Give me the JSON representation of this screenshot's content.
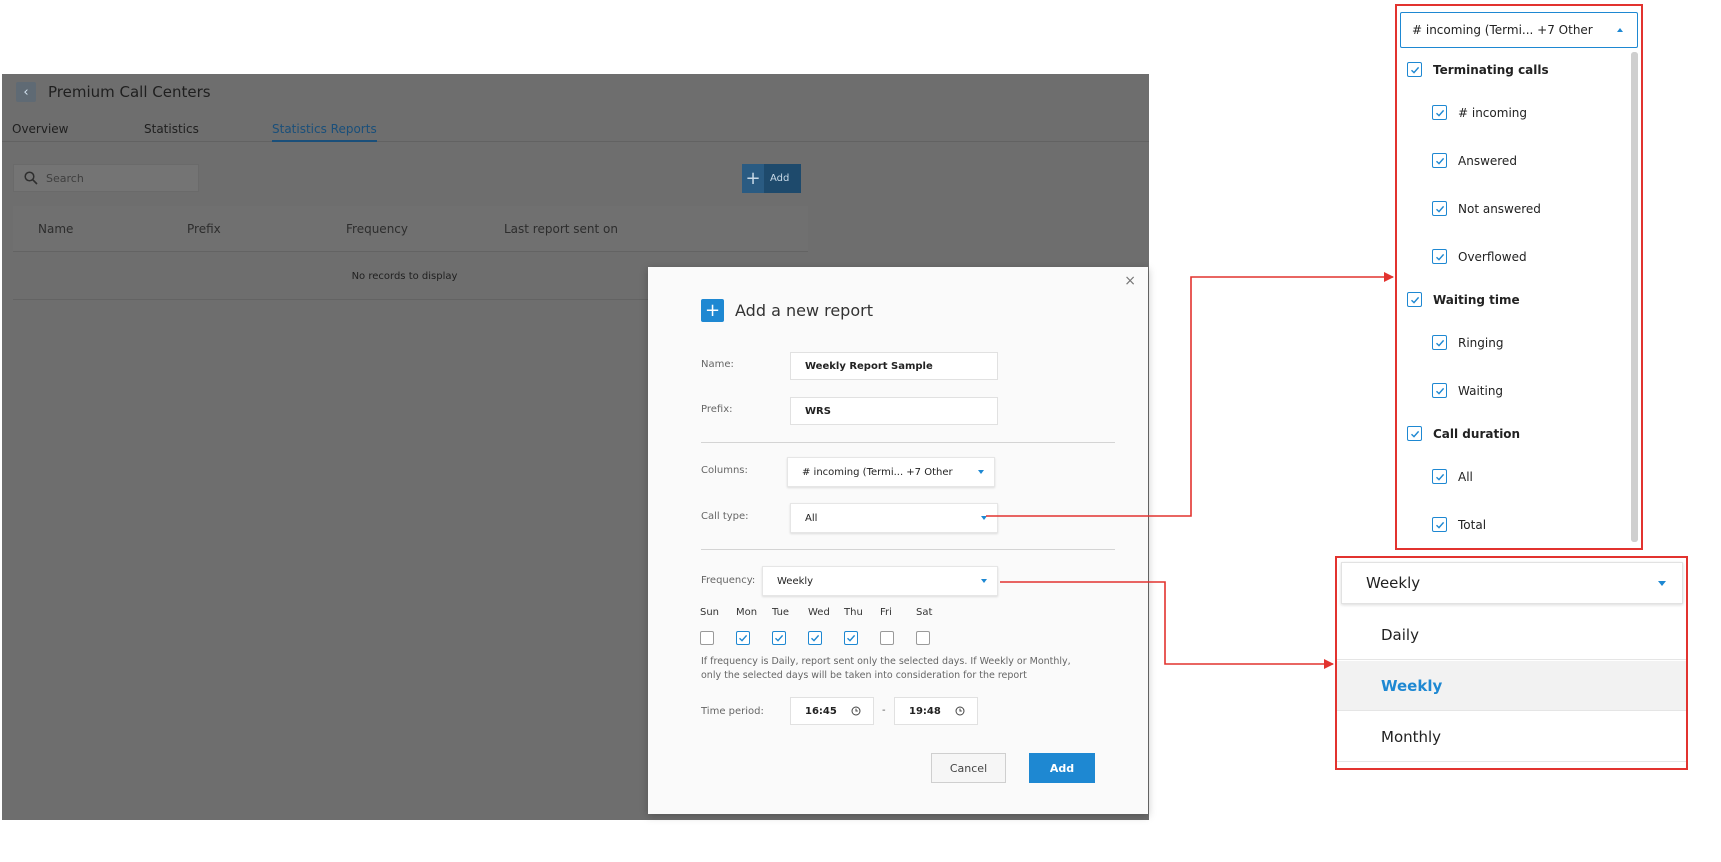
{
  "app": {
    "back_icon": "chevron-left-icon",
    "title": "Premium Call Centers",
    "tabs": [
      "Overview",
      "Statistics",
      "Statistics Reports"
    ],
    "active_tab": "Statistics Reports",
    "search_placeholder": "Search",
    "add_button_label": "Add",
    "table_columns": [
      "Name",
      "Prefix",
      "Frequency",
      "Last report sent on"
    ],
    "empty_message": "No records to display"
  },
  "modal": {
    "title": "Add a new report",
    "close_label": "×",
    "name_label": "Name:",
    "name_value": "Weekly Report Sample",
    "prefix_label": "Prefix:",
    "prefix_value": "WRS",
    "columns_label": "Columns:",
    "columns_value": "# incoming (Termi... +7 Other",
    "call_type_label": "Call type:",
    "call_type_value": "All",
    "frequency_label": "Frequency:",
    "frequency_value": "Weekly",
    "days": [
      {
        "label": "Sun",
        "checked": false
      },
      {
        "label": "Mon",
        "checked": true
      },
      {
        "label": "Tue",
        "checked": true
      },
      {
        "label": "Wed",
        "checked": true
      },
      {
        "label": "Thu",
        "checked": true
      },
      {
        "label": "Fri",
        "checked": false
      },
      {
        "label": "Sat",
        "checked": false
      }
    ],
    "note_line1": "If frequency is Daily, report sent only the selected days. If Weekly or Monthly,",
    "note_line2": "only the selected days will be taken into consideration for the report",
    "time_period_label": "Time period:",
    "time_from": "16:45",
    "time_separator": "-",
    "time_to": "19:48",
    "cancel_label": "Cancel",
    "add_label": "Add"
  },
  "columns_dropdown": {
    "selected_text": "# incoming (Termi... +7 Other",
    "items": [
      {
        "label": "Terminating calls",
        "group": true
      },
      {
        "label": "# incoming",
        "group": false
      },
      {
        "label": "Answered",
        "group": false
      },
      {
        "label": "Not answered",
        "group": false
      },
      {
        "label": "Overflowed",
        "group": false
      },
      {
        "label": "Waiting time",
        "group": true
      },
      {
        "label": "Ringing",
        "group": false
      },
      {
        "label": "Waiting",
        "group": false
      },
      {
        "label": "Call duration",
        "group": true
      },
      {
        "label": "All",
        "group": false
      },
      {
        "label": "Total",
        "group": false
      }
    ]
  },
  "frequency_dropdown": {
    "selected_text": "Weekly",
    "options": [
      "Daily",
      "Weekly",
      "Monthly"
    ],
    "selected_option": "Weekly"
  },
  "colors": {
    "accent": "#1e88d2",
    "highlight_border": "#e2332f",
    "overlay": "#6e6e6e"
  }
}
